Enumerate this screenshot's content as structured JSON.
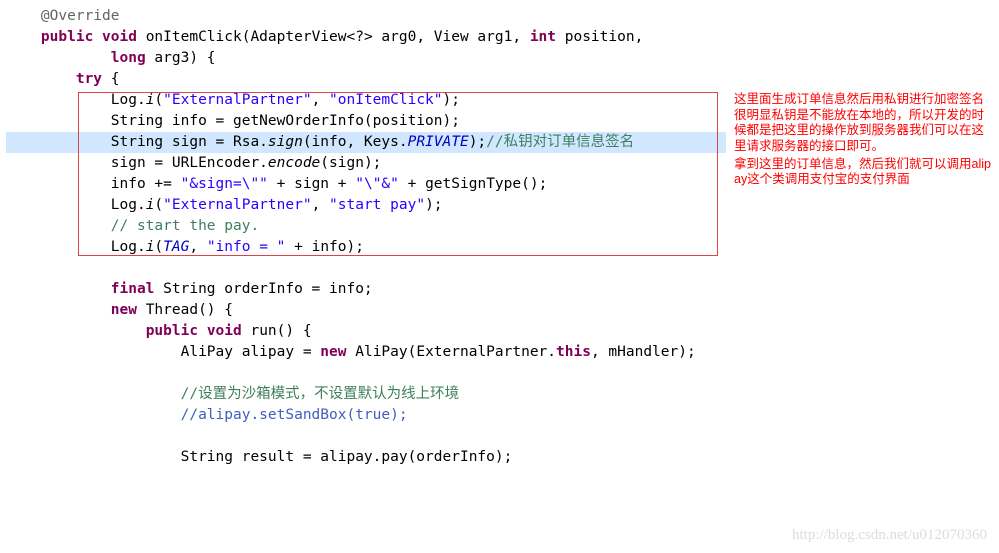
{
  "code": {
    "l1_ann": "@Override",
    "l2_pub": "public",
    "l2_void": "void",
    "l2_method": " onItemClick(AdapterView<?> arg0, View arg1, ",
    "l2_int": "int",
    "l2_pos": " position,",
    "l3_long": "long",
    "l3_arg": " arg3) {",
    "l4_try": "try",
    "l4_brace": " {",
    "l5a": "Log.",
    "l5_i": "i",
    "l5b": "(",
    "l5s1": "\"ExternalPartner\"",
    "l5c": ", ",
    "l5s2": "\"onItemClick\"",
    "l5d": ");",
    "l6": "String info = getNewOrderInfo(position);",
    "l7a": "String sign = Rsa.",
    "l7_sign": "sign",
    "l7b": "(info, Keys.",
    "l7_priv": "PRIVATE",
    "l7c": ");",
    "l7_com": "//私钥对订单信息签名",
    "l8a": "sign = URLEncoder.",
    "l8_enc": "encode",
    "l8b": "(sign);",
    "l9a": "info += ",
    "l9s1": "\"&sign=\\\"\"",
    "l9b": " + sign + ",
    "l9s2": "\"\\\"&\"",
    "l9c": " + getSignType();",
    "l10a": "Log.",
    "l10_i": "i",
    "l10b": "(",
    "l10s1": "\"ExternalPartner\"",
    "l10c": ", ",
    "l10s2": "\"start pay\"",
    "l10d": ");",
    "l11": "// start the pay.",
    "l12a": "Log.",
    "l12_i": "i",
    "l12b": "(",
    "l12_tag": "TAG",
    "l12c": ", ",
    "l12s1": "\"info = \"",
    "l12d": " + info);",
    "l14_final": "final",
    "l14_rest": " String orderInfo = info;",
    "l15_new": "new",
    "l15_rest": " Thread() {",
    "l16_pub": "public",
    "l16_void": "void",
    "l16_rest": " run() {",
    "l17a": "AliPay alipay = ",
    "l17_new": "new",
    "l17b": " AliPay(ExternalPartner.",
    "l17_this": "this",
    "l17c": ", mHandler);",
    "l19": "//设置为沙箱模式，不设置默认为线上环境",
    "l20": "//alipay.setSandBox(true);",
    "l22": "String result = alipay.pay(orderInfo);"
  },
  "annotation": {
    "p1": "这里面生成订单信息然后用私钥进行加密签名很明显私钥是不能放在本地的，所以开发的时候都是把这里的操作放到服务器我们可以在这里请求服务器的接口即可。",
    "p2": "拿到这里的订单信息，然后我们就可以调用alipay这个类调用支付宝的支付界面"
  },
  "watermark": "http://blog.csdn.net/u012070360"
}
